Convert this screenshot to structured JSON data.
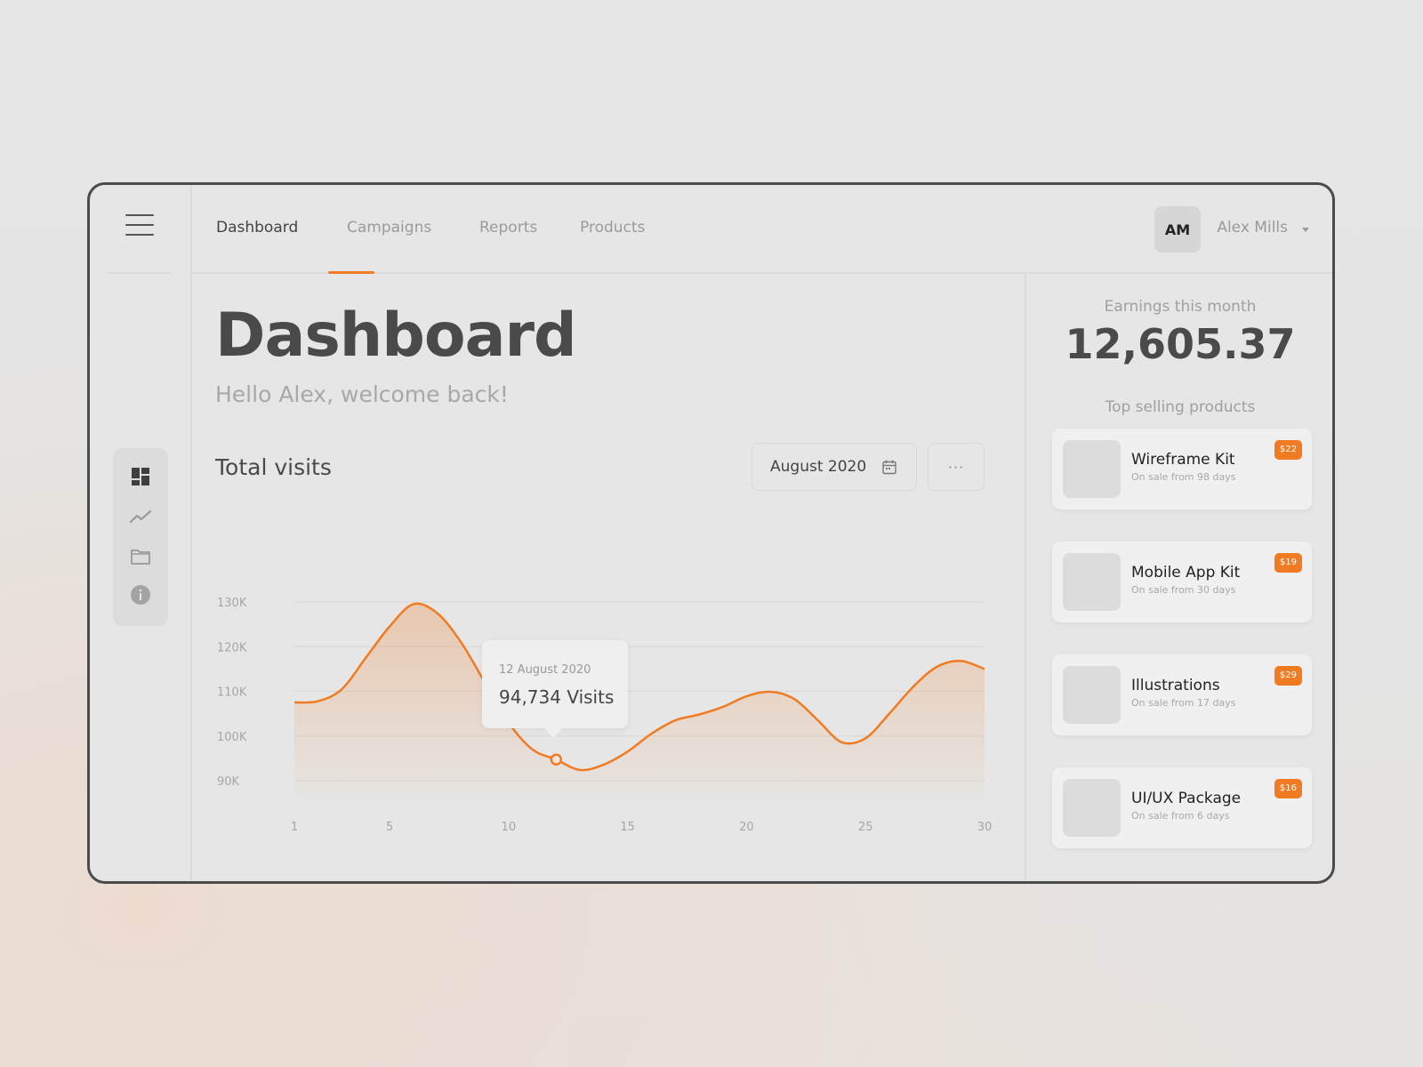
{
  "nav": {
    "tabs": [
      {
        "label": "Dashboard",
        "active": true
      },
      {
        "label": "Campaigns",
        "active": false
      },
      {
        "label": "Reports",
        "active": false
      },
      {
        "label": "Products",
        "active": false
      }
    ],
    "user": {
      "initials": "AM",
      "name": "Alex Mills"
    }
  },
  "sidebar": {
    "icons": [
      "dashboard-icon",
      "trend-icon",
      "folder-icon",
      "info-icon"
    ]
  },
  "main": {
    "title": "Dashboard",
    "welcome": "Hello Alex, welcome back!",
    "section_title": "Total visits",
    "date_filter": "August 2020",
    "more_label": "···",
    "tooltip": {
      "date": "12 August 2020",
      "value": "94,734 Visits"
    }
  },
  "side": {
    "earnings_label": "Earnings this month",
    "earnings_value": "12,605.37",
    "top_selling_label": "Top selling products",
    "products": [
      {
        "name": "Wireframe Kit",
        "sub": "On sale from 98 days",
        "price": "$22"
      },
      {
        "name": "Mobile App Kit",
        "sub": "On sale from 30 days",
        "price": "$19"
      },
      {
        "name": "Illustrations",
        "sub": "On sale from 17 days",
        "price": "$29"
      },
      {
        "name": "UI/UX Package",
        "sub": "On sale from 6 days",
        "price": "$16"
      }
    ]
  },
  "colors": {
    "accent": "#f07b22",
    "text": "#4a4a4a",
    "muted": "#9a9a9a"
  },
  "chart_data": {
    "type": "area",
    "xlabel": "",
    "ylabel": "",
    "x_ticks": [
      1,
      5,
      10,
      15,
      20,
      25,
      30
    ],
    "y_ticks": [
      "90K",
      "100K",
      "110K",
      "120K",
      "130K"
    ],
    "ylim": [
      90000,
      130000
    ],
    "xlim": [
      1,
      30
    ],
    "x": [
      1,
      2,
      3,
      4,
      5,
      6,
      7,
      8,
      9,
      10,
      11,
      12,
      13,
      14,
      15,
      16,
      17,
      18,
      19,
      20,
      21,
      22,
      23,
      24,
      25,
      26,
      27,
      28,
      29,
      30
    ],
    "values": [
      107500,
      107800,
      110500,
      117500,
      124500,
      129500,
      127500,
      121000,
      112000,
      103000,
      97000,
      94734,
      92400,
      93600,
      96500,
      100500,
      103500,
      104800,
      106500,
      108900,
      109900,
      108300,
      103500,
      98600,
      99500,
      105000,
      111000,
      115500,
      116800,
      115000
    ],
    "highlight": {
      "x": 12,
      "y": 94734
    }
  }
}
